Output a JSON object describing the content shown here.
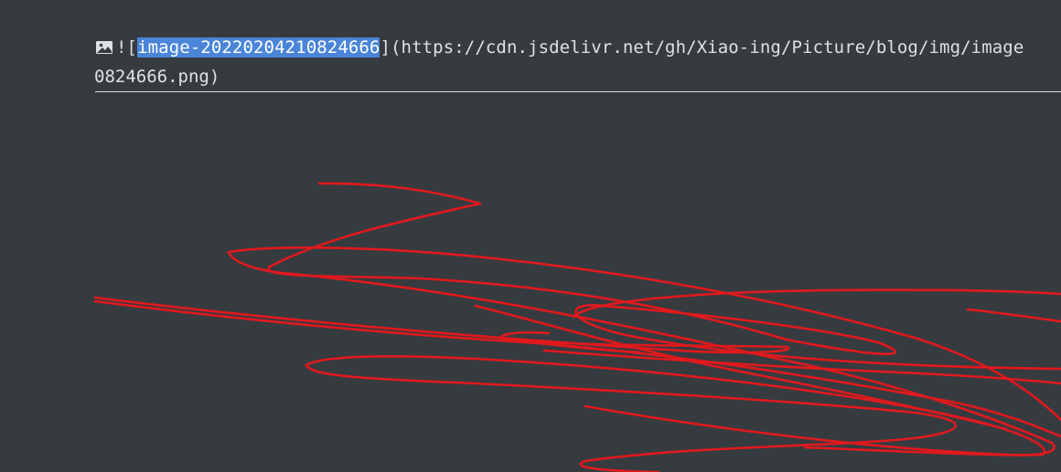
{
  "editor": {
    "line1": {
      "icon": "image-icon",
      "prefix": "![",
      "alt_text_selected": "image-20220204210824666",
      "suffix": "](https://cdn.jsdelivr.net/gh/Xiao-ing/Picture/blog/img/image"
    },
    "line2": {
      "text": "0824666.png)"
    },
    "annotation": {
      "stroke_color": "#e0191d",
      "kind": "red freehand scribble"
    },
    "colors": {
      "background": "#363b40",
      "text": "#dde1e6",
      "selection": "#4a85d8"
    }
  }
}
